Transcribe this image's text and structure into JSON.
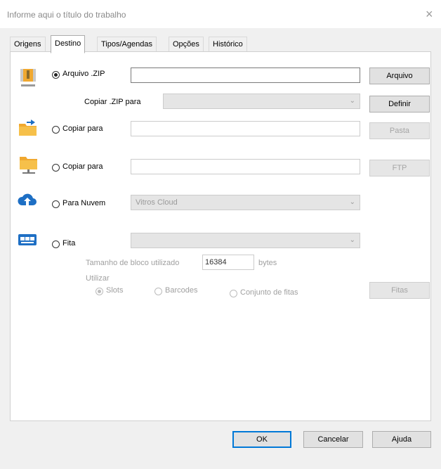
{
  "window": {
    "title": "Informe aqui o título do trabalho",
    "close_glyph": "×"
  },
  "tabs": [
    {
      "label": "Origens",
      "active": false
    },
    {
      "label": "Destino",
      "active": true
    },
    {
      "label": "Tipos/Agendas",
      "active": false
    },
    {
      "label": "Opções",
      "active": false
    },
    {
      "label": "Histórico",
      "active": false
    }
  ],
  "zip": {
    "radio_label": "Arquivo .ZIP",
    "selected": true,
    "path_value": "",
    "browse_button": "Arquivo",
    "copy_label": "Copiar .ZIP para",
    "copy_value": "",
    "define_button": "Definir",
    "icon": "zip-archive-icon"
  },
  "copy_folder": {
    "radio_label": "Copiar para",
    "selected": false,
    "path_value": "",
    "button": "Pasta",
    "icon": "folder-copy-icon"
  },
  "copy_ftp": {
    "radio_label": "Copiar para",
    "selected": false,
    "path_value": "",
    "button": "FTP",
    "icon": "network-folder-icon"
  },
  "cloud": {
    "radio_label": "Para Nuvem",
    "selected": false,
    "combo_value": "Vitros Cloud",
    "icon": "cloud-upload-icon"
  },
  "tape": {
    "radio_label": "Fita",
    "selected": false,
    "combo_value": "",
    "icon": "tape-drive-icon",
    "block_label": "Tamanho de bloco utilizado",
    "block_value": "16384",
    "block_unit": "bytes",
    "use_label": "Utilizar",
    "options": [
      {
        "label": "Slots",
        "selected": true
      },
      {
        "label": "Barcodes",
        "selected": false
      },
      {
        "label": "Conjunto de fitas",
        "selected": false
      }
    ],
    "button": "Fitas"
  },
  "footer": {
    "ok": "OK",
    "cancel": "Cancelar",
    "help": "Ajuda"
  },
  "colors": {
    "accent": "#0078d7",
    "icon_blue": "#1e6fc4",
    "folder_orange": "#f0a830"
  }
}
